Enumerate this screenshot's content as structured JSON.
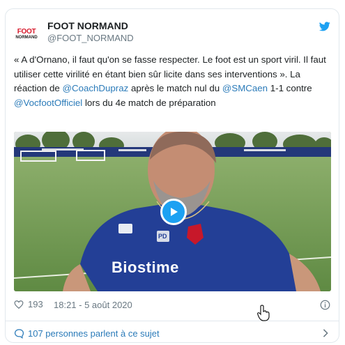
{
  "account": {
    "display_name": "FOOT NORMAND",
    "handle": "@FOOT_NORMAND",
    "avatar_line1": "FOOT",
    "avatar_line2": "NORMAND"
  },
  "tweet": {
    "text_1": "« A d'Ornano, il faut qu'on se fasse respecter. Le foot est un sport viril. Il faut utiliser cette virilité en étant bien sûr licite dans ses interventions ». La réaction de ",
    "mention_1": "@CoachDupraz",
    "text_2": " après le match nul du ",
    "mention_2": "@SMCaen",
    "text_3": " 1-1 contre ",
    "mention_3": "@VocfootOfficiel",
    "text_4": " lors du 4e match de préparation"
  },
  "video": {
    "jersey_brand": "Biostime",
    "jersey_initials": "PD",
    "play_icon": "play-icon"
  },
  "footer": {
    "like_count": "193",
    "timestamp": "18:21 - 5 août 2020"
  },
  "conversation": {
    "label": "107 personnes parlent à ce sujet"
  },
  "colors": {
    "link": "#2b7bb9",
    "twitter_blue": "#1da1f2",
    "muted": "#697882",
    "jersey": "#1f3c8a"
  }
}
